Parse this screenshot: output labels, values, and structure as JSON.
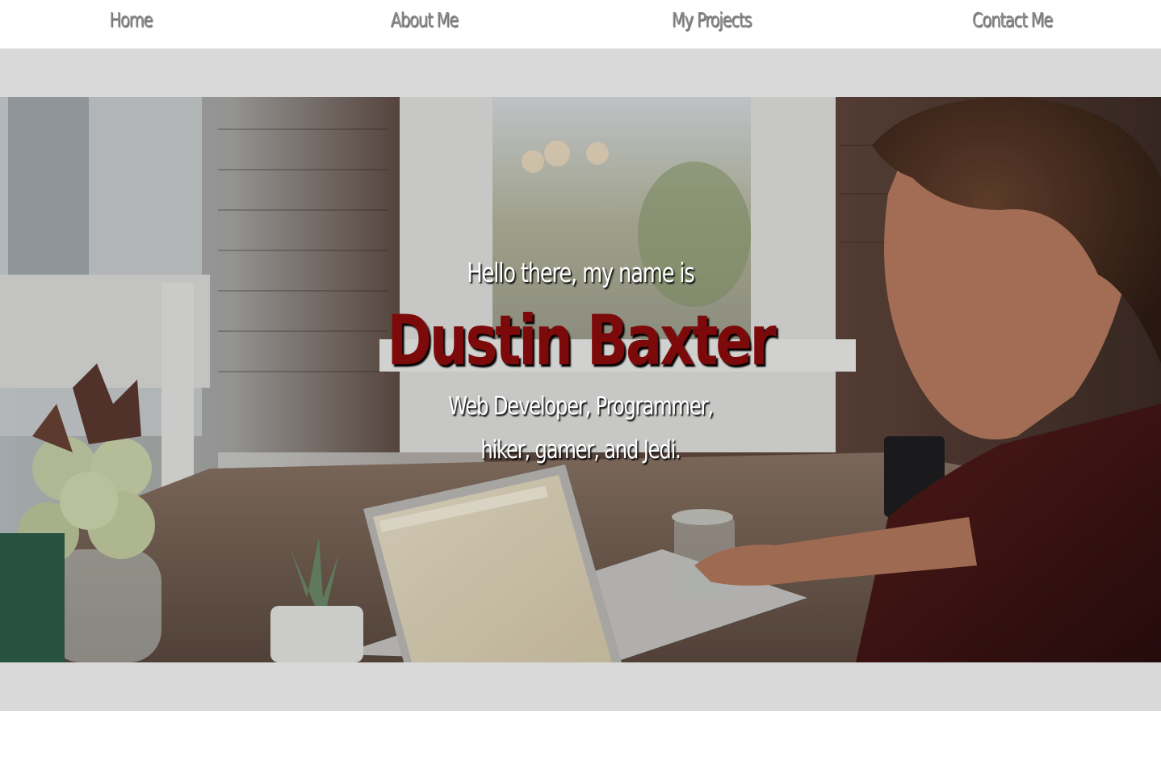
{
  "nav": {
    "items": [
      {
        "label": "Home"
      },
      {
        "label": "About Me"
      },
      {
        "label": "My Projects"
      },
      {
        "label": "Contact Me"
      }
    ]
  },
  "hero": {
    "greeting": "Hello there, my name is",
    "name": "Dustin Baxter",
    "tagline": "Web Developer, Programmer, hiker, gamer, and Jedi.",
    "background_image": "photo of a man working on a laptop at a wooden table in a cafe",
    "name_color": "#7d0a0a"
  },
  "colors": {
    "band": "#d9d9d9",
    "nav_text": "#8a8a8a",
    "hero_text": "#ffffff"
  }
}
